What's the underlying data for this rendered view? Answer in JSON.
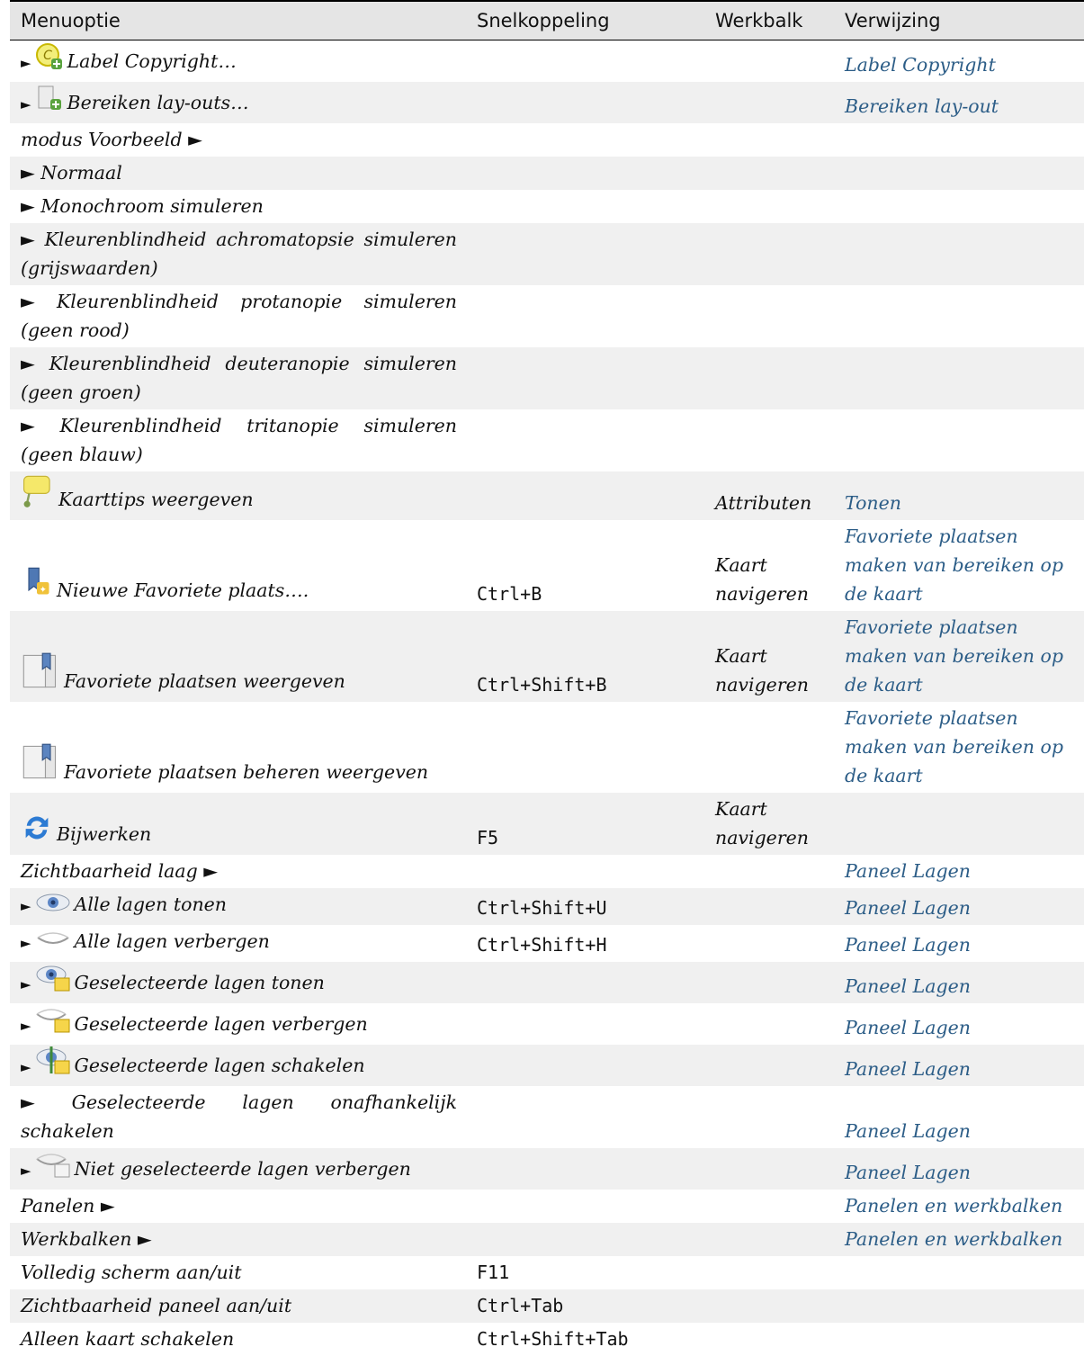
{
  "headers": {
    "menu": "Menuoptie",
    "shortcut": "Snelkoppeling",
    "toolbar": "Werkbalk",
    "reference": "Verwijzing"
  },
  "rows": [
    {
      "menu": "Label Copyright…",
      "arrow_pre": "►",
      "icon": "copyright-label-icon",
      "shortcut": "",
      "toolbar": "",
      "ref": "Label Copyright"
    },
    {
      "menu": "Bereiken lay-outs…",
      "arrow_pre": "►",
      "icon": "extents-layout-icon",
      "shortcut": "",
      "toolbar": "",
      "ref": "Bereiken lay-out"
    },
    {
      "menu": "modus Voorbeeld ►",
      "shortcut": "",
      "toolbar": "",
      "ref": ""
    },
    {
      "menu": "► Normaal",
      "shortcut": "",
      "toolbar": "",
      "ref": ""
    },
    {
      "menu": "► Monochroom simuleren",
      "shortcut": "",
      "toolbar": "",
      "ref": ""
    },
    {
      "menu": "► Kleurenblindheid achromatopsie simuleren (grijswaarden)",
      "shortcut": "",
      "toolbar": "",
      "ref": ""
    },
    {
      "menu": "► Kleurenblindheid protanopie simuleren (geen rood)",
      "shortcut": "",
      "toolbar": "",
      "ref": ""
    },
    {
      "menu": "► Kleurenblindheid deuteranopie simuleren (geen groen)",
      "shortcut": "",
      "toolbar": "",
      "ref": ""
    },
    {
      "menu": "► Kleurenblindheid tritanopie simuleren (geen blauw)",
      "shortcut": "",
      "toolbar": "",
      "ref": ""
    },
    {
      "menu": "Kaarttips weergeven",
      "icon": "map-tips-icon",
      "shortcut": "",
      "toolbar": "Attributen",
      "ref": "Tonen"
    },
    {
      "menu": "Nieuwe Favoriete plaats….",
      "icon": "new-bookmark-icon",
      "shortcut": "Ctrl+B",
      "toolbar": "Kaart navigeren",
      "ref": "Favoriete plaatsen maken van bereiken op de kaart"
    },
    {
      "menu": "Favoriete plaatsen weergeven",
      "icon": "show-bookmarks-icon",
      "shortcut": "Ctrl+Shift+B",
      "toolbar": "Kaart navigeren",
      "ref": "Favoriete plaatsen maken van bereiken op de kaart"
    },
    {
      "menu": "Favoriete plaatsen beheren weergeven",
      "icon": "bookmark-manager-icon",
      "shortcut": "",
      "toolbar": "",
      "ref": "Favoriete plaatsen maken van bereiken op de kaart"
    },
    {
      "menu": "Bijwerken",
      "icon": "refresh-icon",
      "shortcut": "F5",
      "toolbar": "Kaart navigeren",
      "ref": ""
    },
    {
      "menu": "Zichtbaarheid laag ►",
      "shortcut": "",
      "toolbar": "",
      "ref": "Paneel Lagen"
    },
    {
      "menu": "Alle lagen tonen",
      "arrow_pre": "►",
      "icon": "show-all-layers-icon",
      "shortcut": "Ctrl+Shift+U",
      "toolbar": "",
      "ref": "Paneel Lagen"
    },
    {
      "menu": "Alle lagen verbergen",
      "arrow_pre": "►",
      "icon": "hide-all-layers-icon",
      "shortcut": "Ctrl+Shift+H",
      "toolbar": "",
      "ref": "Paneel Lagen"
    },
    {
      "menu": "Geselecteerde lagen tonen",
      "arrow_pre": "►",
      "icon": "show-selected-layers-icon",
      "shortcut": "",
      "toolbar": "",
      "ref": "Paneel Lagen"
    },
    {
      "menu": "Geselecteerde lagen verbergen",
      "arrow_pre": "►",
      "icon": "hide-selected-layers-icon",
      "shortcut": "",
      "toolbar": "",
      "ref": "Paneel Lagen"
    },
    {
      "menu": "Geselecteerde lagen schakelen",
      "arrow_pre": "►",
      "icon": "toggle-selected-layers-icon",
      "shortcut": "",
      "toolbar": "",
      "ref": "Paneel Lagen"
    },
    {
      "menu": "► Geselecteerde lagen onafhankelijk schakelen",
      "shortcut": "",
      "toolbar": "",
      "ref": "Paneel Lagen"
    },
    {
      "menu": "Niet geselecteerde lagen verbergen",
      "arrow_pre": "►",
      "icon": "hide-deselected-layers-icon",
      "shortcut": "",
      "toolbar": "",
      "ref": "Paneel Lagen"
    },
    {
      "menu": "Panelen ►",
      "shortcut": "",
      "toolbar": "",
      "ref": "Panelen en werkbalken"
    },
    {
      "menu": "Werkbalken ►",
      "shortcut": "",
      "toolbar": "",
      "ref": "Panelen en werkbalken"
    },
    {
      "menu": "Volledig scherm aan/uit",
      "shortcut": "F11",
      "toolbar": "",
      "ref": ""
    },
    {
      "menu": "Zichtbaarheid paneel aan/uit",
      "shortcut": "Ctrl+Tab",
      "toolbar": "",
      "ref": ""
    },
    {
      "menu": "Alleen kaart schakelen",
      "shortcut": "Ctrl+Shift+Tab",
      "toolbar": "",
      "ref": ""
    }
  ]
}
